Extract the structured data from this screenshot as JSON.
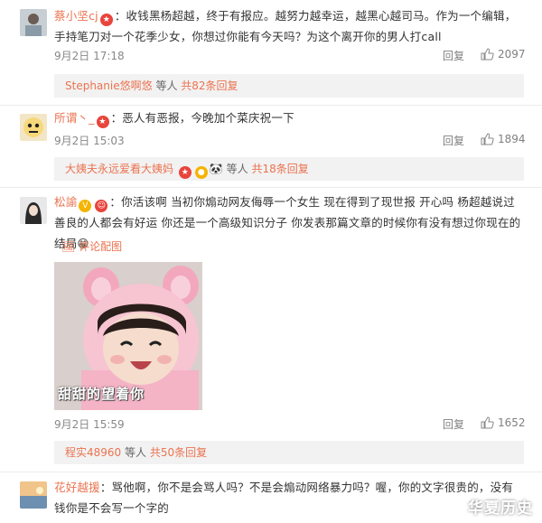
{
  "comments": [
    {
      "user": "蔡小坚cj",
      "badge": "★",
      "text": "：收钱黑杨超越，终于有报应。越努力越幸运，越黑心越司马。作为一个编辑，手持笔刀对一个花季少女，你想过你能有今天吗？为这个离开你的男人打call",
      "time": "9月2日 17:18",
      "reply_label": "回复",
      "likes": "2097",
      "sub": {
        "user": "Stephanie悠啊悠",
        "suffix": "等人",
        "count_text": "共82条回复"
      }
    },
    {
      "user": "所谓丶_",
      "badge": "★",
      "text": "：恶人有恶报，今晚加个菜庆祝一下",
      "time": "9月2日 15:03",
      "reply_label": "回复",
      "likes": "1894",
      "sub": {
        "user": "大姨夫永远爱看大姨妈",
        "suffix": "等人",
        "count_text": "共18条回复"
      }
    },
    {
      "user": "松諭",
      "text": "：你活该啊 当初你煽动网友侮辱一个女生 现在得到了现世报 开心吗 杨超越说过 善良的人都会有好运 你还是一个高级知识分子 你发表那篇文章的时候你有没有想过你现在的结局",
      "image_link": "评论配图",
      "image_caption": "甜甜的望着你",
      "time": "9月2日 15:59",
      "reply_label": "回复",
      "likes": "1652",
      "sub": {
        "user": "程实48960",
        "suffix": "等人",
        "count_text": "共50条回复"
      }
    },
    {
      "user": "花好越援",
      "text": "：骂他啊，你不是会骂人吗？不是会煽动网络暴力吗？喔，你的文字很贵的，没有钱你是不会写一个字的"
    }
  ],
  "watermark": "华夏历史",
  "colors": {
    "username": "#eb7350",
    "subbox": "#f2f2f2",
    "meta": "#888888"
  }
}
